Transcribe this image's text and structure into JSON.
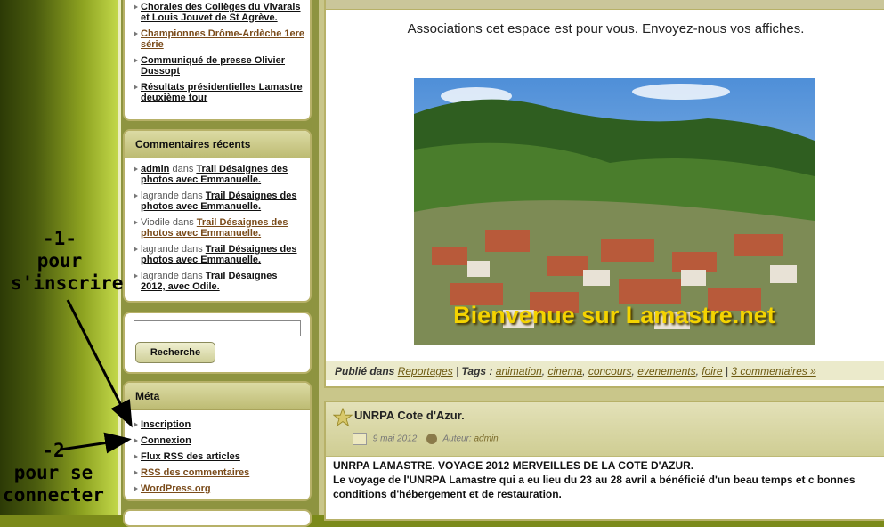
{
  "sidebar": {
    "recent_posts": [
      {
        "text": "Chorales des Collèges du Vivarais et Louis Jouvet de St Agrève.",
        "visited": false
      },
      {
        "text": "Championnes Drôme-Ardèche 1ere série",
        "visited": true
      },
      {
        "text": "Communiqué de presse Olivier Dussopt",
        "visited": false
      },
      {
        "text": "Résultats présidentielles Lamastre deuxième tour",
        "visited": false
      }
    ],
    "comments": {
      "title": "Commentaires récents",
      "items": [
        {
          "author": "admin",
          "sep": " dans ",
          "post": "Trail Désaignes des photos avec Emmanuelle.",
          "visited": false
        },
        {
          "author": "lagrande",
          "sep": " dans ",
          "post": "Trail Désaignes des photos avec Emmanuelle.",
          "visited": false
        },
        {
          "author": "Viodile",
          "sep": " dans ",
          "post": "Trail Désaignes des photos avec Emmanuelle.",
          "visited": true
        },
        {
          "author": "lagrande",
          "sep": " dans ",
          "post": "Trail Désaignes des photos avec Emmanuelle.",
          "visited": false
        },
        {
          "author": "lagrande",
          "sep": " dans ",
          "post": "Trail Désaignes 2012, avec Odile.",
          "visited": false
        }
      ]
    },
    "search": {
      "value": "",
      "button_label": "Recherche"
    },
    "meta": {
      "title": "Méta",
      "items": [
        {
          "label": "Inscription",
          "visited": false
        },
        {
          "label": "Connexion",
          "visited": false
        },
        {
          "label": "Flux RSS des articles",
          "visited": false
        },
        {
          "label": "RSS des commentaires",
          "visited": true
        },
        {
          "label": "WordPress.org",
          "visited": true
        }
      ]
    }
  },
  "annotations": {
    "one": "-1-\npour\ns'inscrire",
    "two": "-2\npour se\nconnecter"
  },
  "post1": {
    "announce": "Associations cet espace est pour vous. Envoyez-nous vos affiches.",
    "photo_caption": "Bienvenue sur Lamastre.net",
    "footer": {
      "published_label": "Publié dans",
      "category": "Reportages",
      "tags_label": "Tags :",
      "tags": [
        "animation",
        "cinema",
        "concours",
        "evenements",
        "foire"
      ],
      "comments": "3 commentaires »"
    }
  },
  "post2": {
    "title": "UNRPA Cote d'Azur.",
    "date": "9 mai 2012",
    "author_label": "Auteur:",
    "author": "admin",
    "headline": "UNRPA LAMASTRE.  VOYAGE 2012 MERVEILLES DE LA COTE D'AZUR.",
    "body": "Le voyage de l'UNRPA Lamastre qui a eu lieu du 23 au 28 avril a bénéficié d'un beau temps et c bonnes conditions d'hébergement et de restauration."
  },
  "colors": {
    "accent": "#b7b168",
    "caption": "#f4d300",
    "link_visited": "#7a4b1a"
  }
}
